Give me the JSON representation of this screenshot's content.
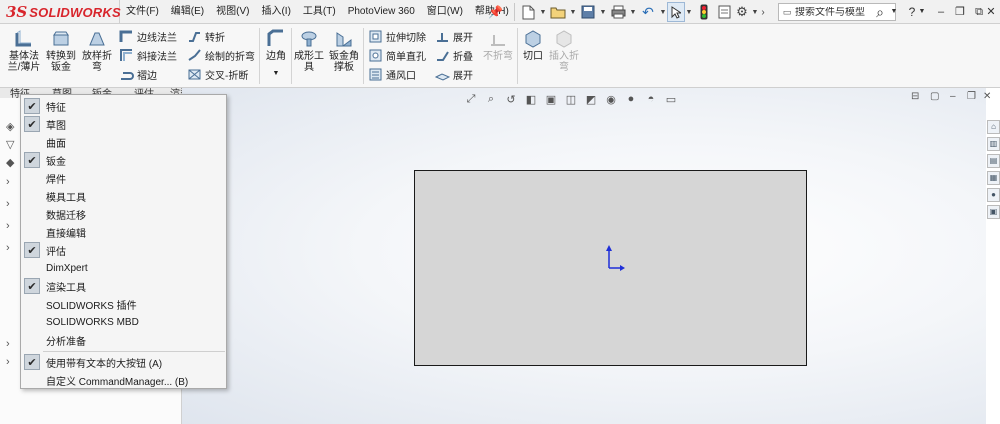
{
  "app": {
    "logo_mark": "3S",
    "logo_text": "SOLIDWORKS"
  },
  "menu": {
    "items": [
      "文件(F)",
      "编辑(E)",
      "视图(V)",
      "插入(I)",
      "工具(T)",
      "PhotoView 360",
      "窗口(W)",
      "帮助(H)"
    ]
  },
  "search": {
    "placeholder": "搜索文件与模型"
  },
  "ribbon": {
    "base_flange": "基体法\n兰/薄片",
    "convert_to_sheet": "转换到\n钣金",
    "lofted_bend": "放样折\n弯",
    "edge_flange": "边线法兰",
    "miter_flange": "斜接法兰",
    "hem": "褶边",
    "jog": "转折",
    "sketched_bend": "绘制的折弯",
    "cross_break": "交叉-折断",
    "corners": "边角",
    "forming_tool": "成形工\n具",
    "sheet_metal_gusset": "钣金角\n撑板",
    "extruded_cut": "拉伸切除",
    "simple_hole": "简单直孔",
    "vent": "通风口",
    "unfold": "展开",
    "fold": "折叠",
    "flatten": "展开",
    "no_bends": "不折弯",
    "rip": "切口",
    "insert_bends": "插入折\n弯"
  },
  "tabs": [
    "特征",
    "草图",
    "钣金",
    "评估",
    "渲染工具"
  ],
  "context_menu": {
    "items": [
      {
        "label": "特征",
        "checked": true
      },
      {
        "label": "草图",
        "checked": true
      },
      {
        "label": "曲面",
        "checked": false
      },
      {
        "label": "钣金",
        "checked": true
      },
      {
        "label": "焊件",
        "checked": false
      },
      {
        "label": "模具工具",
        "checked": false
      },
      {
        "label": "数据迁移",
        "checked": false
      },
      {
        "label": "直接编辑",
        "checked": false
      },
      {
        "label": "评估",
        "checked": true
      },
      {
        "label": "DimXpert",
        "checked": false
      },
      {
        "label": "渲染工具",
        "checked": true
      },
      {
        "label": "SOLIDWORKS 插件",
        "checked": false
      },
      {
        "label": "SOLIDWORKS MBD",
        "checked": false
      },
      {
        "label": "分析准备",
        "checked": false
      }
    ],
    "footer": [
      {
        "label": "使用带有文本的大按钮 (A)",
        "checked": true
      },
      {
        "label": "自定义 CommandManager... (B)",
        "checked": false
      }
    ],
    "check_glyph": "✔"
  },
  "colors": {
    "brand": "#d8252c",
    "accent": "#2c6fb7",
    "sketch_fill": "#d6d6d6",
    "origin": "#1f2fd8"
  }
}
